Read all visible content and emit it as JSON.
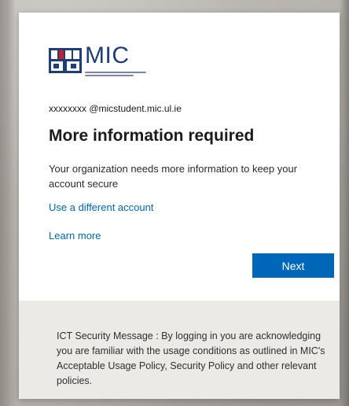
{
  "logo": {
    "text": "MIC",
    "icon": "mic-crest-icon"
  },
  "account": {
    "email": "xxxxxxxx @micstudent.mic.ul.ie"
  },
  "main": {
    "title": "More information required",
    "subtitle": "Your organization needs more information to keep your account secure",
    "use_different_account_label": "Use a different account",
    "learn_more_label": "Learn more",
    "next_button_label": "Next"
  },
  "footer": {
    "message": "ICT Security Message : By logging in you are acknowledging you are familiar with the usage conditions as outlined in MIC's Acceptable Usage Policy, Security Policy and other relevant policies."
  },
  "colors": {
    "brand": "#1f3d7a",
    "accent": "#0067b8",
    "card_bg": "#ffffff",
    "footer_bg": "#eceae6"
  }
}
